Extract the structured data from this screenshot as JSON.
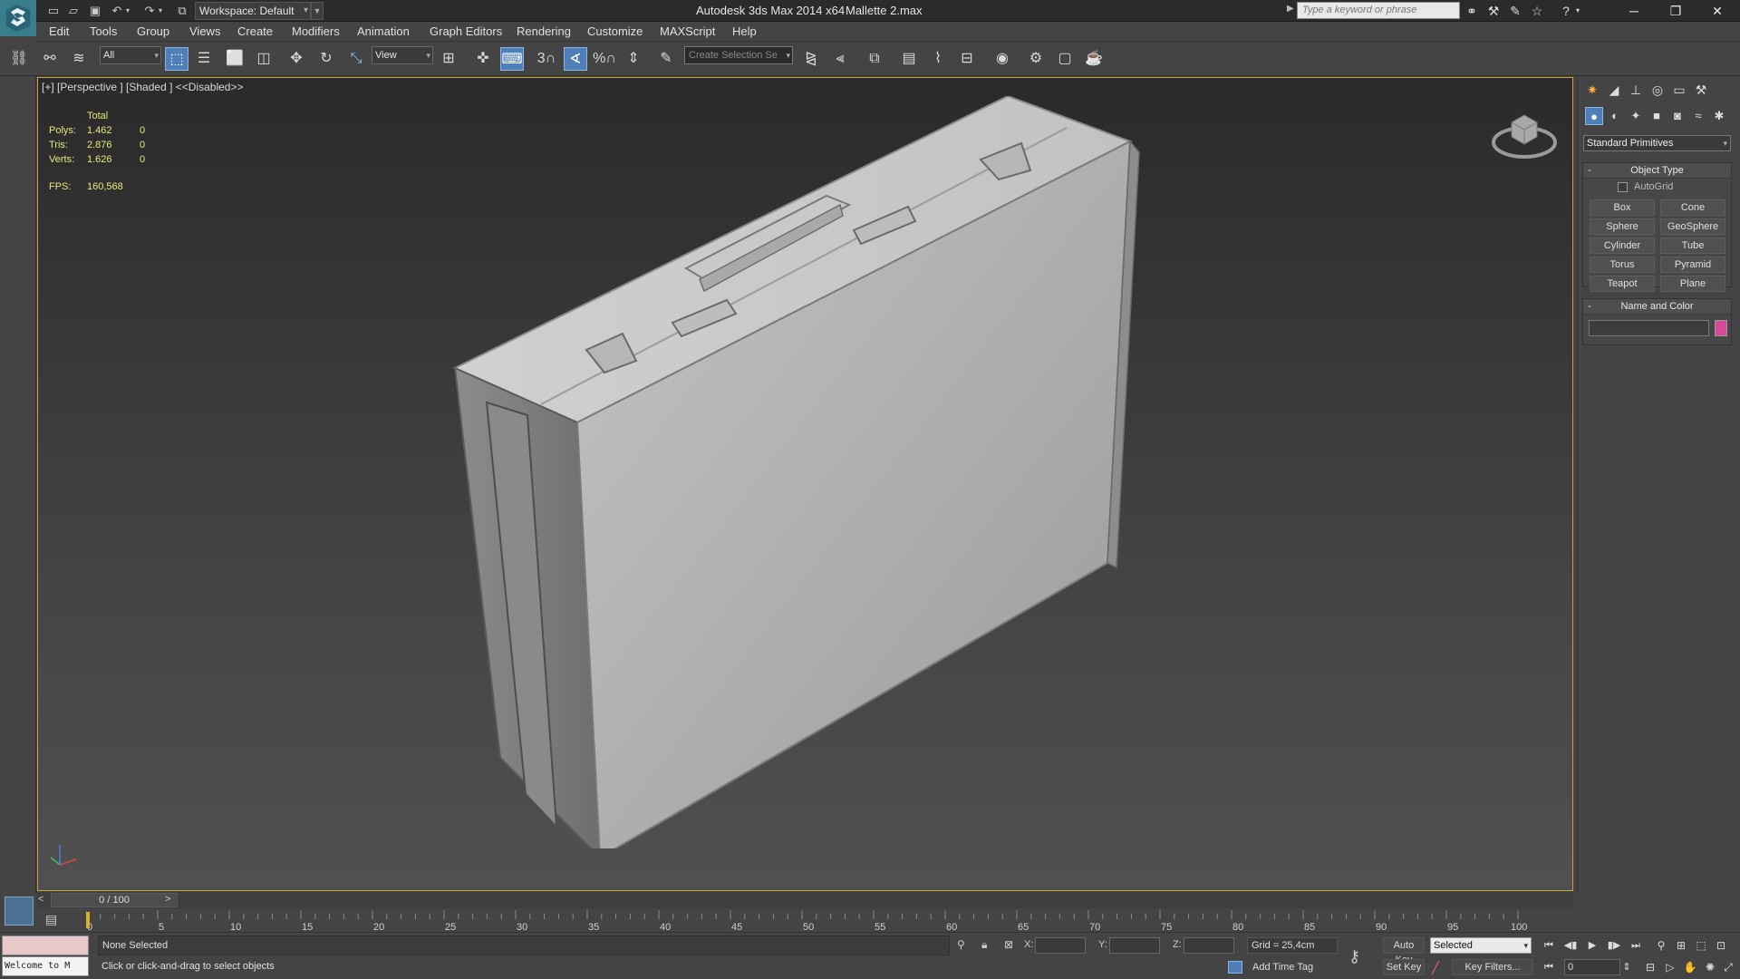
{
  "titlebar": {
    "workspace": "Workspace: Default",
    "app_title": "Autodesk 3ds Max  2014 x64",
    "file_title": "Mallette 2.max",
    "search_placeholder": "Type a keyword or phrase"
  },
  "menu": [
    "Edit",
    "Tools",
    "Group",
    "Views",
    "Create",
    "Modifiers",
    "Animation",
    "Graph Editors",
    "Rendering",
    "Customize",
    "MAXScript",
    "Help"
  ],
  "toolbar": {
    "selection_filter": "All",
    "ref_coord": "View",
    "snap_value": "3",
    "angle_snap_value": "%",
    "selection_set_placeholder": "Create Selection Se"
  },
  "viewport": {
    "label": "[+] [Perspective ] [Shaded ]  <<Disabled>>",
    "stats": {
      "header": "Total",
      "rows": [
        {
          "label": "Polys:",
          "total": "1.462",
          "sel": "0"
        },
        {
          "label": "Tris:",
          "total": "2.876",
          "sel": "0"
        },
        {
          "label": "Verts:",
          "total": "1.626",
          "sel": "0"
        }
      ],
      "fps_label": "FPS:",
      "fps_value": "160,568"
    }
  },
  "command_panel": {
    "category": "Standard Primitives",
    "object_type": {
      "title": "Object Type",
      "autogrid": "AutoGrid",
      "buttons": [
        "Box",
        "Cone",
        "Sphere",
        "GeoSphere",
        "Cylinder",
        "Tube",
        "Torus",
        "Pyramid",
        "Teapot",
        "Plane"
      ]
    },
    "name_color": {
      "title": "Name and Color",
      "name_value": "",
      "swatch_color": "#d9499a"
    }
  },
  "timeslider": {
    "position": "0 / 100",
    "left_arrow": "<",
    "right_arrow": ">"
  },
  "track": {
    "ticks": [
      "0",
      "5",
      "10",
      "15",
      "20",
      "25",
      "30",
      "35",
      "40",
      "45",
      "50",
      "55",
      "60",
      "65",
      "70",
      "75",
      "80",
      "85",
      "90",
      "95",
      "100"
    ]
  },
  "statusbar": {
    "listener_text": "Welcome to M",
    "selection": "None Selected",
    "prompt": "Click or click-and-drag to select objects",
    "x_label": "X:",
    "y_label": "Y:",
    "z_label": "Z:",
    "grid": "Grid = 25,4cm",
    "add_time_tag": "Add Time Tag",
    "auto_key": "Auto Key",
    "set_key": "Set Key",
    "key_mode": "Selected",
    "key_filters": "Key Filters...",
    "frame": "0"
  },
  "colors": {
    "viewport_border": "#c9a33a",
    "active_button": "#4e7fb8",
    "stats_text": "#e8e87a"
  }
}
